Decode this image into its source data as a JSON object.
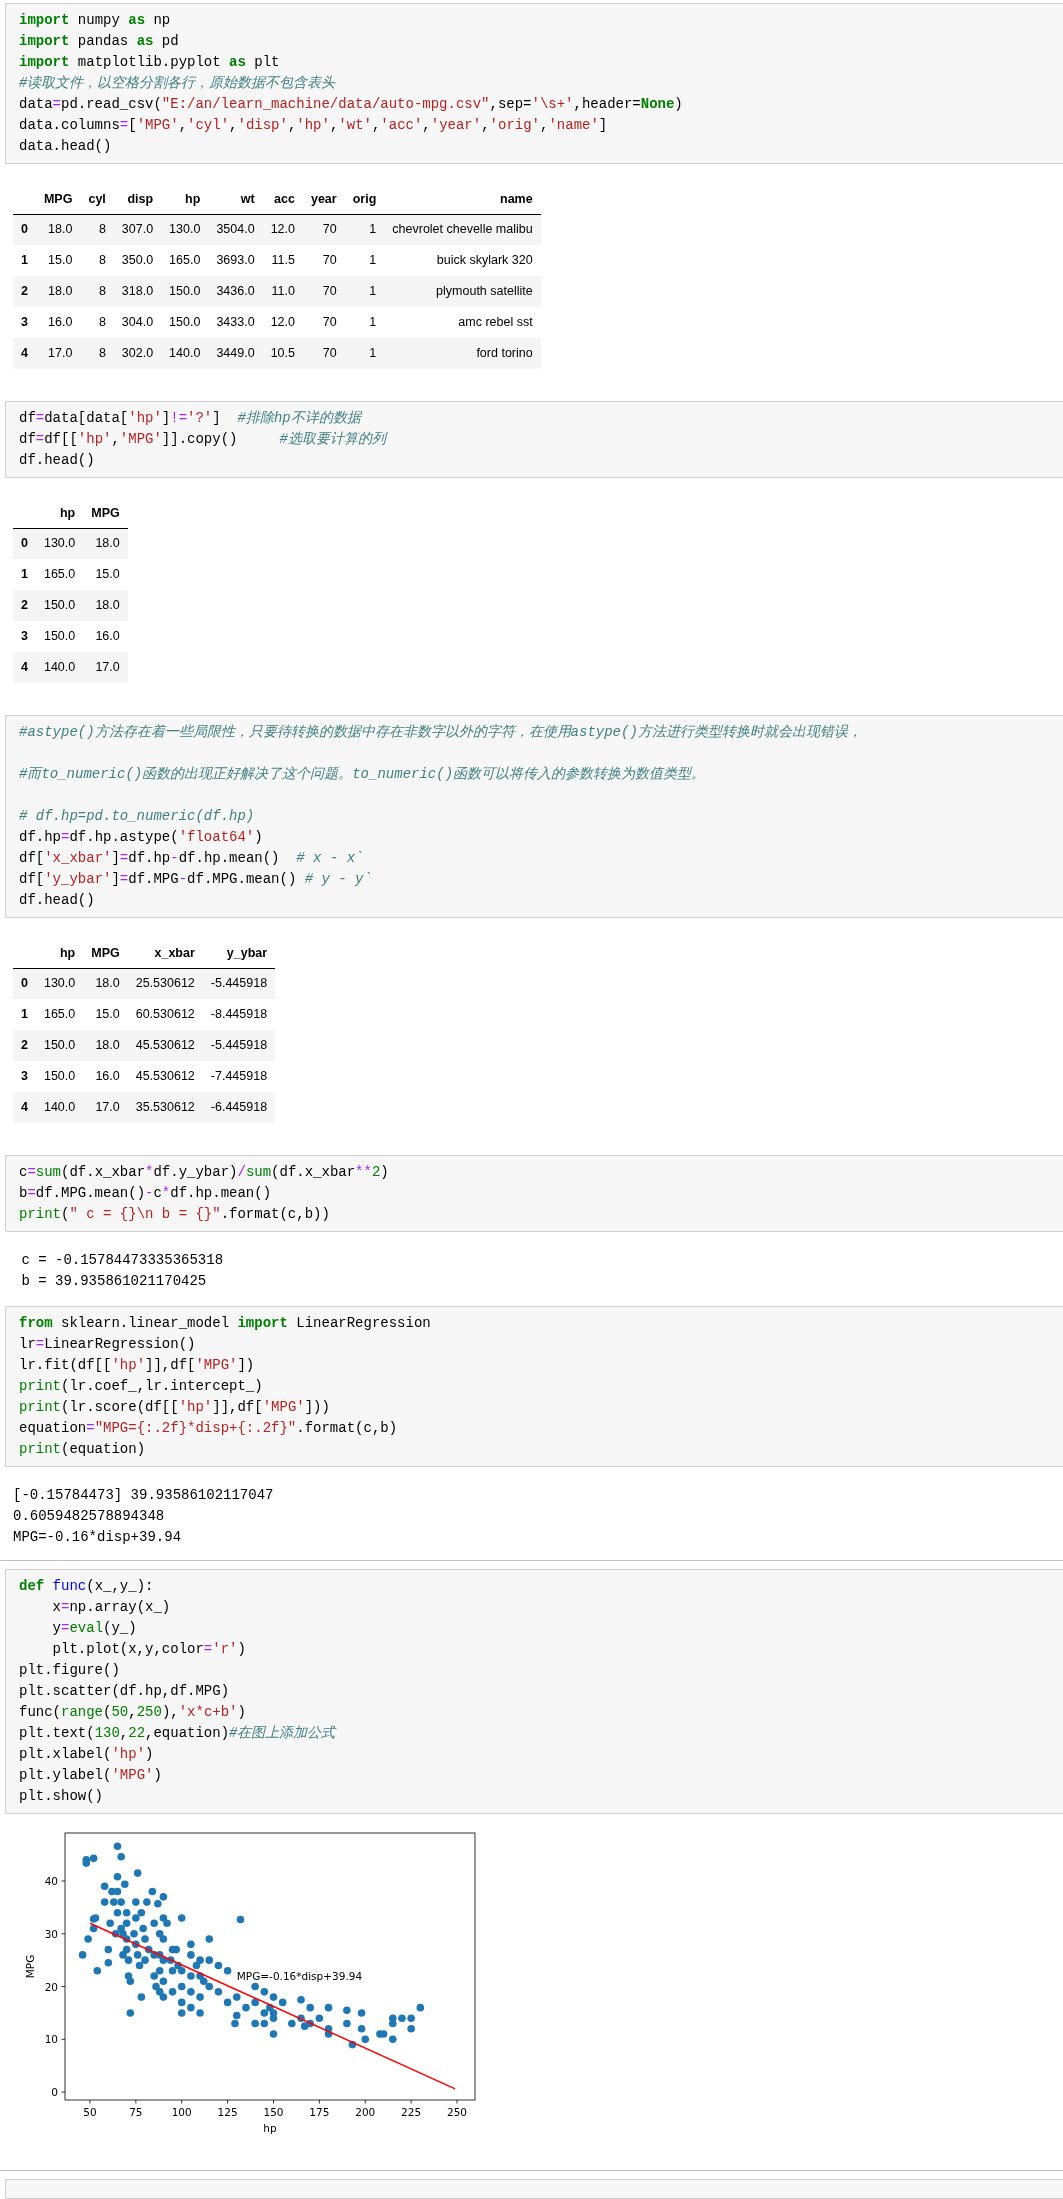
{
  "cells": [
    {
      "kind": "code",
      "lines": [
        {
          "tokens": [
            {
              "kind": "keyword",
              "text": "import"
            },
            {
              "kind": "plain",
              "text": " numpy "
            },
            {
              "kind": "keyword",
              "text": "as"
            },
            {
              "kind": "plain",
              "text": " np"
            }
          ]
        },
        {
          "tokens": [
            {
              "kind": "keyword",
              "text": "import"
            },
            {
              "kind": "plain",
              "text": " pandas "
            },
            {
              "kind": "keyword",
              "text": "as"
            },
            {
              "kind": "plain",
              "text": " pd"
            }
          ]
        },
        {
          "tokens": [
            {
              "kind": "keyword",
              "text": "import"
            },
            {
              "kind": "plain",
              "text": " matplotlib.pyplot "
            },
            {
              "kind": "keyword",
              "text": "as"
            },
            {
              "kind": "plain",
              "text": " plt"
            }
          ]
        },
        {
          "tokens": [
            {
              "kind": "comment",
              "text": "#读取文件，以空格分割各行，原始数据不包含表头"
            }
          ]
        },
        {
          "tokens": [
            {
              "kind": "plain",
              "text": "data"
            },
            {
              "kind": "operator",
              "text": "="
            },
            {
              "kind": "plain",
              "text": "pd.read_csv("
            },
            {
              "kind": "string",
              "text": "\"E:/an/learn_machine/data/auto-mpg.csv\""
            },
            {
              "kind": "plain",
              "text": ",sep="
            },
            {
              "kind": "string",
              "text": "'\\s+'"
            },
            {
              "kind": "plain",
              "text": ",header="
            },
            {
              "kind": "keyword",
              "text": "None"
            },
            {
              "kind": "plain",
              "text": ")"
            }
          ]
        },
        {
          "tokens": [
            {
              "kind": "plain",
              "text": "data.columns"
            },
            {
              "kind": "operator",
              "text": "="
            },
            {
              "kind": "plain",
              "text": "["
            },
            {
              "kind": "string",
              "text": "'MPG'"
            },
            {
              "kind": "plain",
              "text": ","
            },
            {
              "kind": "string",
              "text": "'cyl'"
            },
            {
              "kind": "plain",
              "text": ","
            },
            {
              "kind": "string",
              "text": "'disp'"
            },
            {
              "kind": "plain",
              "text": ","
            },
            {
              "kind": "string",
              "text": "'hp'"
            },
            {
              "kind": "plain",
              "text": ","
            },
            {
              "kind": "string",
              "text": "'wt'"
            },
            {
              "kind": "plain",
              "text": ","
            },
            {
              "kind": "string",
              "text": "'acc'"
            },
            {
              "kind": "plain",
              "text": ","
            },
            {
              "kind": "string",
              "text": "'year'"
            },
            {
              "kind": "plain",
              "text": ","
            },
            {
              "kind": "string",
              "text": "'orig'"
            },
            {
              "kind": "plain",
              "text": ","
            },
            {
              "kind": "string",
              "text": "'name'"
            },
            {
              "kind": "plain",
              "text": "]"
            }
          ]
        },
        {
          "tokens": [
            {
              "kind": "plain",
              "text": "data.head()"
            }
          ]
        }
      ]
    },
    {
      "kind": "table",
      "columns": [
        "MPG",
        "cyl",
        "disp",
        "hp",
        "wt",
        "acc",
        "year",
        "orig",
        "name"
      ],
      "rows": [
        {
          "index": "0",
          "cells": [
            "18.0",
            "8",
            "307.0",
            "130.0",
            "3504.0",
            "12.0",
            "70",
            "1",
            "chevrolet chevelle malibu"
          ]
        },
        {
          "index": "1",
          "cells": [
            "15.0",
            "8",
            "350.0",
            "165.0",
            "3693.0",
            "11.5",
            "70",
            "1",
            "buick skylark 320"
          ]
        },
        {
          "index": "2",
          "cells": [
            "18.0",
            "8",
            "318.0",
            "150.0",
            "3436.0",
            "11.0",
            "70",
            "1",
            "plymouth satellite"
          ]
        },
        {
          "index": "3",
          "cells": [
            "16.0",
            "8",
            "304.0",
            "150.0",
            "3433.0",
            "12.0",
            "70",
            "1",
            "amc rebel sst"
          ]
        },
        {
          "index": "4",
          "cells": [
            "17.0",
            "8",
            "302.0",
            "140.0",
            "3449.0",
            "10.5",
            "70",
            "1",
            "ford torino"
          ]
        }
      ]
    },
    {
      "kind": "code",
      "lines": [
        {
          "tokens": [
            {
              "kind": "plain",
              "text": "df"
            },
            {
              "kind": "operator",
              "text": "="
            },
            {
              "kind": "plain",
              "text": "data[data["
            },
            {
              "kind": "string",
              "text": "'hp'"
            },
            {
              "kind": "plain",
              "text": "]"
            },
            {
              "kind": "operator",
              "text": "!="
            },
            {
              "kind": "string",
              "text": "'?'"
            },
            {
              "kind": "plain",
              "text": "]  "
            },
            {
              "kind": "comment",
              "text": "#排除hp不详的数据"
            }
          ]
        },
        {
          "tokens": [
            {
              "kind": "plain",
              "text": "df"
            },
            {
              "kind": "operator",
              "text": "="
            },
            {
              "kind": "plain",
              "text": "df[["
            },
            {
              "kind": "string",
              "text": "'hp'"
            },
            {
              "kind": "plain",
              "text": ","
            },
            {
              "kind": "string",
              "text": "'MPG'"
            },
            {
              "kind": "plain",
              "text": "]].copy()     "
            },
            {
              "kind": "comment",
              "text": "#选取要计算的列"
            }
          ]
        },
        {
          "tokens": [
            {
              "kind": "plain",
              "text": "df.head()"
            }
          ]
        }
      ]
    },
    {
      "kind": "table",
      "columns": [
        "hp",
        "MPG"
      ],
      "rows": [
        {
          "index": "0",
          "cells": [
            "130.0",
            "18.0"
          ]
        },
        {
          "index": "1",
          "cells": [
            "165.0",
            "15.0"
          ]
        },
        {
          "index": "2",
          "cells": [
            "150.0",
            "18.0"
          ]
        },
        {
          "index": "3",
          "cells": [
            "150.0",
            "16.0"
          ]
        },
        {
          "index": "4",
          "cells": [
            "140.0",
            "17.0"
          ]
        }
      ]
    },
    {
      "kind": "code",
      "lines": [
        {
          "tokens": [
            {
              "kind": "comment",
              "text": "#astype()方法存在着一些局限性，只要待转换的数据中存在非数字以外的字符，在使用astype()方法进行类型转换时就会出现错误，"
            }
          ]
        },
        {
          "gap_before": true,
          "tokens": [
            {
              "kind": "comment",
              "text": "#而to_numeric()函数的出现正好解决了这个问题。to_numeric()函数可以将传入的参数转换为数值类型。"
            }
          ]
        },
        {
          "gap_before": true,
          "tokens": [
            {
              "kind": "comment",
              "text": "# df.hp=pd.to_numeric(df.hp)"
            }
          ]
        },
        {
          "tokens": [
            {
              "kind": "plain",
              "text": "df.hp"
            },
            {
              "kind": "operator",
              "text": "="
            },
            {
              "kind": "plain",
              "text": "df.hp.astype("
            },
            {
              "kind": "string",
              "text": "'float64'"
            },
            {
              "kind": "plain",
              "text": ")"
            }
          ]
        },
        {
          "tokens": [
            {
              "kind": "plain",
              "text": "df["
            },
            {
              "kind": "string",
              "text": "'x_xbar'"
            },
            {
              "kind": "plain",
              "text": "]"
            },
            {
              "kind": "operator",
              "text": "="
            },
            {
              "kind": "plain",
              "text": "df.hp"
            },
            {
              "kind": "operator",
              "text": "-"
            },
            {
              "kind": "plain",
              "text": "df.hp.mean()  "
            },
            {
              "kind": "comment",
              "text": "# x - x`"
            }
          ]
        },
        {
          "tokens": [
            {
              "kind": "plain",
              "text": "df["
            },
            {
              "kind": "string",
              "text": "'y_ybar'"
            },
            {
              "kind": "plain",
              "text": "]"
            },
            {
              "kind": "operator",
              "text": "="
            },
            {
              "kind": "plain",
              "text": "df.MPG"
            },
            {
              "kind": "operator",
              "text": "-"
            },
            {
              "kind": "plain",
              "text": "df.MPG.mean() "
            },
            {
              "kind": "comment",
              "text": "# y - y`"
            }
          ]
        },
        {
          "tokens": [
            {
              "kind": "plain",
              "text": "df.head()"
            }
          ]
        }
      ]
    },
    {
      "kind": "table",
      "columns": [
        "hp",
        "MPG",
        "x_xbar",
        "y_ybar"
      ],
      "rows": [
        {
          "index": "0",
          "cells": [
            "130.0",
            "18.0",
            "25.530612",
            "-5.445918"
          ]
        },
        {
          "index": "1",
          "cells": [
            "165.0",
            "15.0",
            "60.530612",
            "-8.445918"
          ]
        },
        {
          "index": "2",
          "cells": [
            "150.0",
            "18.0",
            "45.530612",
            "-5.445918"
          ]
        },
        {
          "index": "3",
          "cells": [
            "150.0",
            "16.0",
            "45.530612",
            "-7.445918"
          ]
        },
        {
          "index": "4",
          "cells": [
            "140.0",
            "17.0",
            "35.530612",
            "-6.445918"
          ]
        }
      ]
    },
    {
      "kind": "code",
      "lines": [
        {
          "tokens": [
            {
              "kind": "plain",
              "text": "c"
            },
            {
              "kind": "operator",
              "text": "="
            },
            {
              "kind": "builtin",
              "text": "sum"
            },
            {
              "kind": "plain",
              "text": "(df.x_xbar"
            },
            {
              "kind": "operator",
              "text": "*"
            },
            {
              "kind": "plain",
              "text": "df.y_ybar)"
            },
            {
              "kind": "operator",
              "text": "/"
            },
            {
              "kind": "builtin",
              "text": "sum"
            },
            {
              "kind": "plain",
              "text": "(df.x_xbar"
            },
            {
              "kind": "operator",
              "text": "**"
            },
            {
              "kind": "number",
              "text": "2"
            },
            {
              "kind": "plain",
              "text": ")"
            }
          ]
        },
        {
          "tokens": [
            {
              "kind": "plain",
              "text": "b"
            },
            {
              "kind": "operator",
              "text": "="
            },
            {
              "kind": "plain",
              "text": "df.MPG.mean()"
            },
            {
              "kind": "operator",
              "text": "-"
            },
            {
              "kind": "plain",
              "text": "c"
            },
            {
              "kind": "operator",
              "text": "*"
            },
            {
              "kind": "plain",
              "text": "df.hp.mean()"
            }
          ]
        },
        {
          "tokens": [
            {
              "kind": "builtin",
              "text": "print"
            },
            {
              "kind": "plain",
              "text": "("
            },
            {
              "kind": "string",
              "text": "\" c = {}\\n b = {}\""
            },
            {
              "kind": "plain",
              "text": ".format(c,b))"
            }
          ]
        }
      ]
    },
    {
      "kind": "output",
      "lines": [
        " c = -0.15784473335365318",
        " b = 39.935861021170425"
      ]
    },
    {
      "kind": "code",
      "lines": [
        {
          "tokens": [
            {
              "kind": "keyword",
              "text": "from"
            },
            {
              "kind": "plain",
              "text": " sklearn.linear_model "
            },
            {
              "kind": "keyword",
              "text": "import"
            },
            {
              "kind": "plain",
              "text": " LinearRegression"
            }
          ]
        },
        {
          "tokens": [
            {
              "kind": "plain",
              "text": "lr"
            },
            {
              "kind": "operator",
              "text": "="
            },
            {
              "kind": "plain",
              "text": "LinearRegression()"
            }
          ]
        },
        {
          "tokens": [
            {
              "kind": "plain",
              "text": "lr.fit(df[["
            },
            {
              "kind": "string",
              "text": "'hp'"
            },
            {
              "kind": "plain",
              "text": "]],df["
            },
            {
              "kind": "string",
              "text": "'MPG'"
            },
            {
              "kind": "plain",
              "text": "])"
            }
          ]
        },
        {
          "tokens": [
            {
              "kind": "builtin",
              "text": "print"
            },
            {
              "kind": "plain",
              "text": "(lr.coef_,lr.intercept_)"
            }
          ]
        },
        {
          "tokens": [
            {
              "kind": "builtin",
              "text": "print"
            },
            {
              "kind": "plain",
              "text": "(lr.score(df[["
            },
            {
              "kind": "string",
              "text": "'hp'"
            },
            {
              "kind": "plain",
              "text": "]],df["
            },
            {
              "kind": "string",
              "text": "'MPG'"
            },
            {
              "kind": "plain",
              "text": "]))"
            }
          ]
        },
        {
          "tokens": [
            {
              "kind": "plain",
              "text": "equation"
            },
            {
              "kind": "operator",
              "text": "="
            },
            {
              "kind": "string",
              "text": "\"MPG={:.2f}*disp+{:.2f}\""
            },
            {
              "kind": "plain",
              "text": ".format(c,b)"
            }
          ]
        },
        {
          "tokens": [
            {
              "kind": "builtin",
              "text": "print"
            },
            {
              "kind": "plain",
              "text": "(equation)"
            }
          ]
        }
      ]
    },
    {
      "kind": "output",
      "divider_after": true,
      "lines": [
        "[-0.15784473] 39.93586102117047",
        "0.6059482578894348",
        "MPG=-0.16*disp+39.94"
      ]
    },
    {
      "kind": "code",
      "lines": [
        {
          "tokens": [
            {
              "kind": "keyword",
              "text": "def"
            },
            {
              "kind": "function",
              "text": " func"
            },
            {
              "kind": "plain",
              "text": "(x_,y_):"
            }
          ]
        },
        {
          "tokens": [
            {
              "kind": "plain",
              "text": "    x"
            },
            {
              "kind": "operator",
              "text": "="
            },
            {
              "kind": "plain",
              "text": "np.array(x_)"
            }
          ]
        },
        {
          "tokens": [
            {
              "kind": "plain",
              "text": "    y"
            },
            {
              "kind": "operator",
              "text": "="
            },
            {
              "kind": "builtin",
              "text": "eval"
            },
            {
              "kind": "plain",
              "text": "(y_)"
            }
          ]
        },
        {
          "tokens": [
            {
              "kind": "plain",
              "text": "    plt.plot(x,y,color"
            },
            {
              "kind": "operator",
              "text": "="
            },
            {
              "kind": "string",
              "text": "'r'"
            },
            {
              "kind": "plain",
              "text": ")"
            }
          ]
        },
        {
          "tokens": [
            {
              "kind": "plain",
              "text": "plt.figure()"
            }
          ]
        },
        {
          "tokens": [
            {
              "kind": "plain",
              "text": "plt.scatter(df.hp,df.MPG)"
            }
          ]
        },
        {
          "tokens": [
            {
              "kind": "plain",
              "text": "func("
            },
            {
              "kind": "builtin",
              "text": "range"
            },
            {
              "kind": "plain",
              "text": "("
            },
            {
              "kind": "number",
              "text": "50"
            },
            {
              "kind": "plain",
              "text": ","
            },
            {
              "kind": "number",
              "text": "250"
            },
            {
              "kind": "plain",
              "text": "),"
            },
            {
              "kind": "string",
              "text": "'x*c+b'"
            },
            {
              "kind": "plain",
              "text": ")"
            }
          ]
        },
        {
          "tokens": [
            {
              "kind": "plain",
              "text": "plt.text("
            },
            {
              "kind": "number",
              "text": "130"
            },
            {
              "kind": "plain",
              "text": ","
            },
            {
              "kind": "number",
              "text": "22"
            },
            {
              "kind": "plain",
              "text": ",equation)"
            },
            {
              "kind": "comment",
              "text": "#在图上添加公式"
            }
          ]
        },
        {
          "tokens": [
            {
              "kind": "plain",
              "text": "plt.xlabel("
            },
            {
              "kind": "string",
              "text": "'hp'"
            },
            {
              "kind": "plain",
              "text": ")"
            }
          ]
        },
        {
          "tokens": [
            {
              "kind": "plain",
              "text": "plt.ylabel("
            },
            {
              "kind": "string",
              "text": "'MPG'"
            },
            {
              "kind": "plain",
              "text": ")"
            }
          ]
        },
        {
          "tokens": [
            {
              "kind": "plain",
              "text": "plt.show()"
            }
          ]
        }
      ]
    },
    {
      "kind": "chart",
      "divider_after": true,
      "chart_data": {
        "type": "scatter",
        "xlabel": "hp",
        "ylabel": "MPG",
        "xlim": [
          36.4,
          259.8
        ],
        "ylim": [
          -1.5,
          49.1
        ],
        "xticks": [
          50,
          75,
          100,
          125,
          150,
          175,
          200,
          225,
          250
        ],
        "yticks": [
          0,
          10,
          20,
          30,
          40
        ],
        "annotations": [
          "MPG=-0.16*disp+39.94"
        ],
        "series": [
          {
            "type": "scatter",
            "color": "#1f77b4",
            "x": [
              46,
              48,
              48,
              49,
              52,
              52,
              52,
              53,
              54,
              58,
              58,
              60,
              60,
              61,
              62,
              63,
              64,
              65,
              65,
              65,
              65,
              67,
              67,
              67,
              68,
              68,
              69,
              70,
              70,
              70,
              70,
              71,
              71,
              72,
              72,
              74,
              75,
              75,
              75,
              76,
              76,
              77,
              78,
              78,
              79,
              80,
              80,
              81,
              82,
              84,
              85,
              85,
              85,
              86,
              87,
              88,
              88,
              88,
              88,
              90,
              90,
              90,
              90,
              90,
              90,
              92,
              94,
              95,
              95,
              95,
              97,
              98,
              100,
              100,
              100,
              100,
              100,
              105,
              105,
              105,
              105,
              105,
              108,
              110,
              110,
              110,
              110,
              112,
              115,
              115,
              115,
              120,
              120,
              125,
              125,
              129,
              130,
              130,
              132,
              135,
              140,
              140,
              140,
              145,
              145,
              145,
              148,
              150,
              150,
              150,
              150,
              155,
              160,
              165,
              165,
              167,
              170,
              170,
              175,
              180,
              180,
              180,
              190,
              190,
              193,
              198,
              198,
              200,
              208,
              210,
              215,
              215,
              215,
              220,
              225,
              225,
              230
            ],
            "values": [
              26,
              44,
              43.4,
              29,
              44.3,
              32.8,
              31,
              33,
              23,
              39,
              36,
              27,
              24.5,
              32,
              38,
              36,
              30,
              46.6,
              40.8,
              38,
              34,
              44.6,
              36,
              31,
              30,
              26,
              39.4,
              34,
              32,
              29,
              27,
              25,
              22,
              21,
              15,
              30,
              36,
              33,
              28,
              41.5,
              26,
              24,
              34,
              18,
              31,
              29,
              25,
              36,
              27,
              38,
              32,
              26,
              22,
              20,
              35.7,
              30,
              26,
              23,
              19,
              37,
              33,
              29,
              25,
              21,
              18,
              32,
              25,
              27,
              23,
              19,
              27,
              24,
              33,
              23,
              20,
              17,
              15,
              28,
              26,
              22,
              19,
              16,
              24,
              25,
              22,
              18,
              15,
              21,
              29,
              25,
              20,
              24,
              19,
              23,
              17,
              13,
              18,
              14.5,
              32.7,
              16,
              20,
              17,
              13,
              19,
              15,
              13,
              16,
              18,
              15,
              14,
              11,
              17,
              13,
              17.5,
              14,
              12.5,
              16,
              13,
              14,
              16,
              12,
              11,
              15.5,
              13,
              9,
              15,
              12,
              10,
              11,
              11,
              14,
              13,
              10,
              14,
              14,
              12,
              16
            ]
          },
          {
            "type": "line",
            "color": "#ff0000",
            "x": [
              50,
              249
            ],
            "values": [
              32,
              0.6
            ]
          }
        ]
      }
    },
    {
      "kind": "code"
    }
  ]
}
